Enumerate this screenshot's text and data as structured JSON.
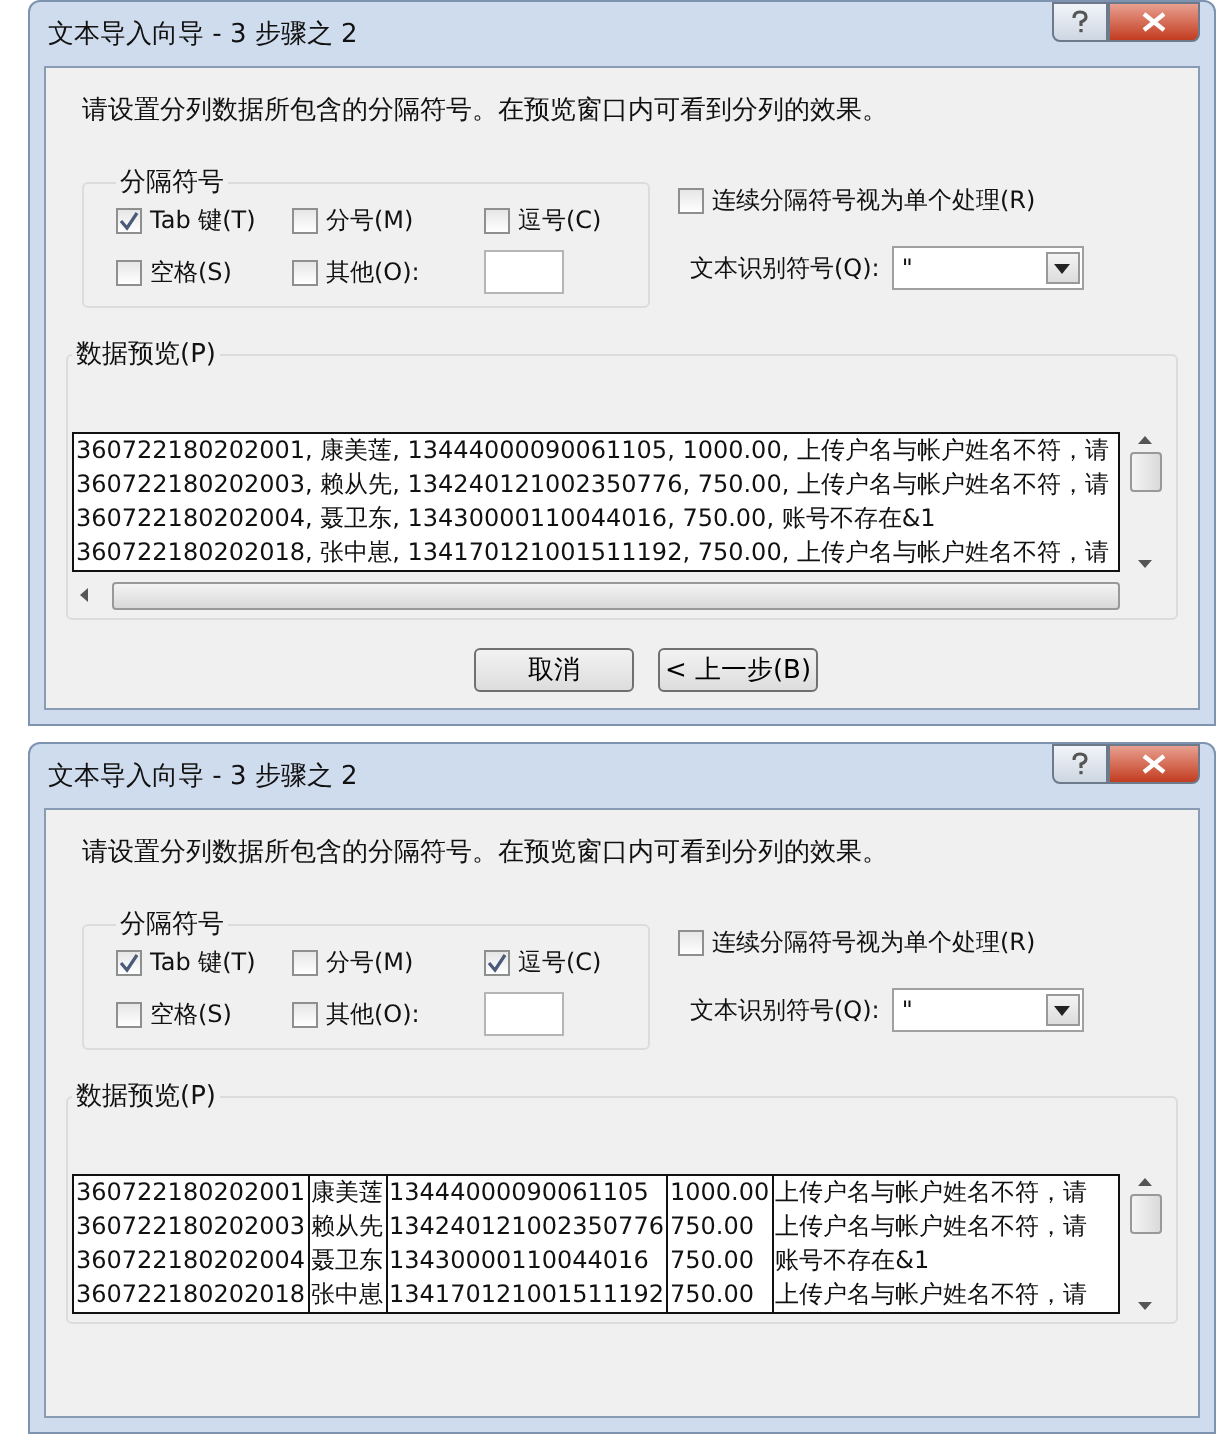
{
  "dialogs": [
    {
      "title": "文本导入向导 - 3 步骤之 2",
      "instruction": "请设置分列数据所包含的分隔符号。在预览窗口内可看到分列的效果。",
      "delimiters": {
        "legend": "分隔符号",
        "options": [
          {
            "label": "Tab 键(T)",
            "checked": true
          },
          {
            "label": "分号(M)",
            "checked": false
          },
          {
            "label": "逗号(C)",
            "checked": false
          },
          {
            "label": "空格(S)",
            "checked": false
          },
          {
            "label": "其他(O):",
            "checked": false
          }
        ]
      },
      "consecutive": {
        "label": "连续分隔符号视为单个处理(R)",
        "checked": false
      },
      "qualifier": {
        "label": "文本识别符号(Q):",
        "value": "\""
      },
      "preview": {
        "label": "数据预览(P)",
        "kind": "text",
        "rows": [
          [
            "360722180202001, 康美莲, 13444000090061105, 1000.00, 上传户名与帐户姓名不符，请"
          ],
          [
            "360722180202003, 赖从先, 134240121002350776, 750.00, 上传户名与帐户姓名不符，请"
          ],
          [
            "360722180202004, 聂卫东, 13430000110044016, 750.00, 账号不存在&1"
          ],
          [
            "360722180202018, 张中崽, 134170121001511192, 750.00, 上传户名与帐户姓名不符，请"
          ]
        ]
      },
      "buttons": [
        "取消",
        "< 上一步(B)"
      ]
    },
    {
      "title": "文本导入向导 - 3 步骤之 2",
      "instruction": "请设置分列数据所包含的分隔符号。在预览窗口内可看到分列的效果。",
      "delimiters": {
        "legend": "分隔符号",
        "options": [
          {
            "label": "Tab 键(T)",
            "checked": true
          },
          {
            "label": "分号(M)",
            "checked": false
          },
          {
            "label": "逗号(C)",
            "checked": true
          },
          {
            "label": "空格(S)",
            "checked": false
          },
          {
            "label": "其他(O):",
            "checked": false
          }
        ]
      },
      "consecutive": {
        "label": "连续分隔符号视为单个处理(R)",
        "checked": false
      },
      "qualifier": {
        "label": "文本识别符号(Q):",
        "value": "\""
      },
      "preview": {
        "label": "数据预览(P)",
        "kind": "columns",
        "rows": [
          [
            "360722180202001",
            "康美莲",
            "13444000090061105",
            "1000.00",
            "上传户名与帐户姓名不符，请"
          ],
          [
            "360722180202003",
            "赖从先",
            "134240121002350776",
            "750.00",
            "上传户名与帐户姓名不符，请"
          ],
          [
            "360722180202004",
            "聂卫东",
            "13430000110044016",
            "750.00",
            "账号不存在&1"
          ],
          [
            "360722180202018",
            "张中崽",
            "134170121001511192",
            "750.00",
            "上传户名与帐户姓名不符，请"
          ]
        ]
      }
    }
  ]
}
